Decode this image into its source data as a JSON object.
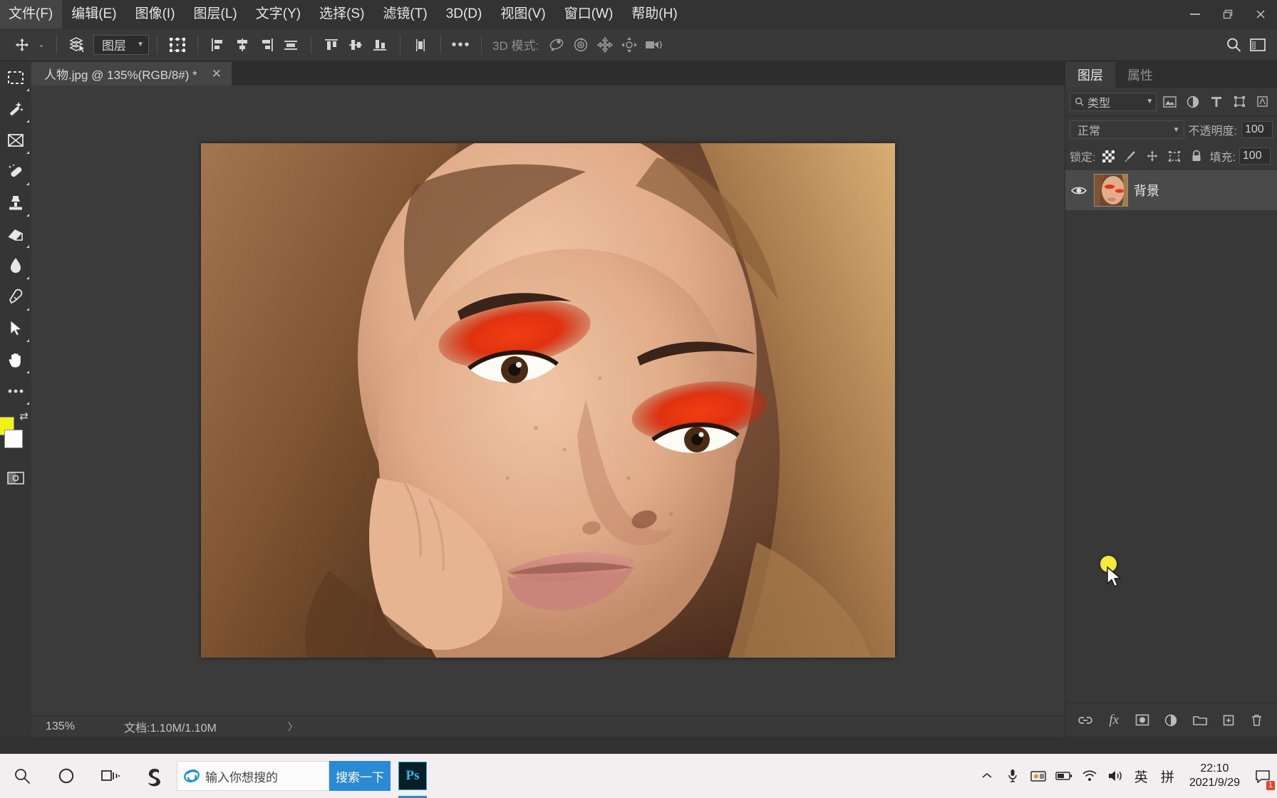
{
  "menubar": {
    "items": [
      {
        "label": "文件(F)",
        "name": "menu-file"
      },
      {
        "label": "编辑(E)",
        "name": "menu-edit"
      },
      {
        "label": "图像(I)",
        "name": "menu-image"
      },
      {
        "label": "图层(L)",
        "name": "menu-layer"
      },
      {
        "label": "文字(Y)",
        "name": "menu-type"
      },
      {
        "label": "选择(S)",
        "name": "menu-select"
      },
      {
        "label": "滤镜(T)",
        "name": "menu-filter"
      },
      {
        "label": "3D(D)",
        "name": "menu-3d"
      },
      {
        "label": "视图(V)",
        "name": "menu-view"
      },
      {
        "label": "窗口(W)",
        "name": "menu-window"
      },
      {
        "label": "帮助(H)",
        "name": "menu-help"
      }
    ],
    "window_controls": {
      "minimize": "minimize-icon",
      "restore": "restore-icon",
      "close": "✕"
    }
  },
  "options_bar": {
    "move_tool_icon": "move-tool-icon",
    "tool_preset_chevron": "⌄",
    "auto_select_icon": "auto-select-layers-icon",
    "auto_select_value": "图层",
    "transform_controls_icon": "show-transform-controls-icon",
    "align_icons": [
      "align-left-edges-icon",
      "align-horizontal-centers-icon",
      "align-right-edges-icon",
      "align-top-edges-icon"
    ],
    "distribute_icons": [
      "align-top-edges-icon",
      "align-vertical-centers-icon",
      "align-bottom-edges-icon",
      "distribute-icon"
    ],
    "more_label": "•••",
    "mode_3d_label": "3D 模式:",
    "mode_3d_icons": [
      "rotate-3d-icon",
      "roll-3d-icon",
      "pan-3d-icon",
      "slide-3d-icon",
      "camera-3d-icon"
    ],
    "search_icon": "search-icon",
    "workspace_icon": "workspace-panel-icon"
  },
  "toolbar": {
    "tools": [
      {
        "name": "marquee-tool",
        "glyph": "marquee"
      },
      {
        "name": "quick-selection-tool",
        "glyph": "wand"
      },
      {
        "name": "crop-tool",
        "glyph": "crop"
      },
      {
        "name": "healing-brush-tool",
        "glyph": "bandage"
      },
      {
        "name": "clone-stamp-tool",
        "glyph": "stamp"
      },
      {
        "name": "eraser-tool",
        "glyph": "eraser"
      },
      {
        "name": "blur-tool",
        "glyph": "drop"
      },
      {
        "name": "pen-tool",
        "glyph": "pen"
      },
      {
        "name": "path-selection-tool",
        "glyph": "arrow"
      },
      {
        "name": "hand-tool",
        "glyph": "hand"
      },
      {
        "name": "edit-toolbar",
        "glyph": "dots"
      }
    ],
    "foreground_color": "#f2f21a",
    "background_color": "#ffffff",
    "swap_icon": "swap-colors-icon",
    "quickmask_icon": "quick-mask-icon"
  },
  "document": {
    "tab_title": "人物.jpg @ 135%(RGB/8#) *",
    "tab_close": "✕"
  },
  "statusbar": {
    "zoom": "135%",
    "doc_info": "文档:1.10M/1.10M",
    "arrow": "〉"
  },
  "layers_panel": {
    "tabs": [
      {
        "label": "图层",
        "name": "tab-layers",
        "active": true
      },
      {
        "label": "属性",
        "name": "tab-properties",
        "active": false
      }
    ],
    "filter": {
      "search_icon": "search-icon",
      "type_label": "类型",
      "chevron": "⌄",
      "kind_icons": [
        "pixel-layer-filter-icon",
        "adjustment-layer-filter-icon",
        "type-layer-filter-icon",
        "shape-layer-filter-icon",
        "smart-object-filter-icon"
      ]
    },
    "blend_mode": "正常",
    "blend_chevron": "⌄",
    "opacity_label": "不透明度:",
    "opacity_value": "100",
    "lock_label": "锁定:",
    "lock_icons": [
      "lock-transparent-pixels-icon",
      "lock-image-pixels-icon",
      "lock-position-icon",
      "lock-artboard-nesting-icon",
      "lock-all-icon"
    ],
    "fill_label": "填充:",
    "fill_value": "100",
    "layers": [
      {
        "name": "背景",
        "visible_icon": "eye-icon",
        "thumbnail": "layer-thumbnail-portrait",
        "selected": true
      }
    ],
    "footer_icons": [
      "link-layers-icon",
      "layer-style-fx-icon",
      "add-layer-mask-icon",
      "new-adjustment-layer-icon",
      "new-group-icon",
      "new-layer-icon",
      "delete-layer-icon"
    ],
    "footer_fx_label": "fx"
  },
  "taskbar": {
    "search_icon": "search-icon",
    "cortana_icon": "cortana-circle-icon",
    "taskview_icon": "task-view-icon",
    "app_icon": "sogou-icon",
    "browser_icon": "internet-explorer-icon",
    "search_placeholder": "输入你想搜的",
    "search_button_label": "搜索一下",
    "photoshop_label": "Ps",
    "tray": {
      "chevron": "⌃",
      "mic_icon": "microphone-icon",
      "screenshot_icon": "screenshot-icon",
      "battery_icon": "battery-icon",
      "wifi_icon": "wifi-icon",
      "volume_icon": "volume-icon",
      "ime_lang": "英",
      "ime_pinyin": "拼",
      "time": "22:10",
      "date": "2021/9/29",
      "notify_icon": "notifications-icon",
      "notify_badge": "1"
    }
  }
}
